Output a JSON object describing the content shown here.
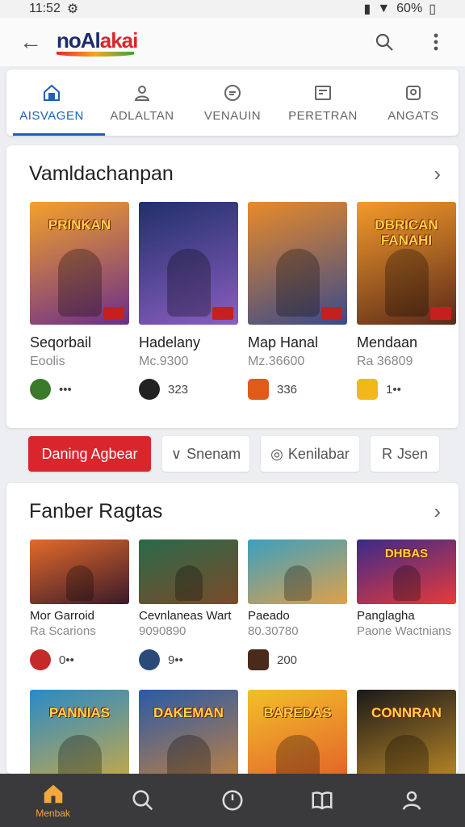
{
  "status": {
    "time": "11:52",
    "battery": "60%"
  },
  "app": {
    "logo_part1": "noAl",
    "logo_part2": "akai"
  },
  "tabs": [
    {
      "label": "AISVAGEN",
      "icon": "home-icon"
    },
    {
      "label": "ADLALTAN",
      "icon": "person-icon"
    },
    {
      "label": "VENAUIN",
      "icon": "badge-icon"
    },
    {
      "label": "PERETRAN",
      "icon": "board-icon"
    },
    {
      "label": "ANGATS",
      "icon": "tag-icon"
    }
  ],
  "section1": {
    "title": "Vamldachanpan",
    "games": [
      {
        "name": "Seqorbail",
        "sub": "Eoolis",
        "meta": "•••",
        "thumb_text": "PRINKAN",
        "avatar_color": "#3a7a2a",
        "colors": [
          "#f4a12a",
          "#6a2e8a"
        ]
      },
      {
        "name": "Hadelany",
        "sub": "Mc.9300",
        "meta": "323",
        "thumb_text": "",
        "avatar_color": "#222222",
        "colors": [
          "#20306a",
          "#8a5ec0"
        ]
      },
      {
        "name": "Map Hanal",
        "sub": "Mz.36600",
        "meta": "336",
        "thumb_text": "",
        "avatar_color": "#e05a1a",
        "colors": [
          "#e88a2a",
          "#3a4a8a"
        ]
      },
      {
        "name": "Mendaan",
        "sub": "Ra 36809",
        "meta": "1••",
        "thumb_text": "DBRICAN FANAHI",
        "avatar_color": "#f2b81a",
        "colors": [
          "#f59a2a",
          "#5a2a1a"
        ]
      }
    ]
  },
  "chips": [
    {
      "label": "Daning Agbear"
    },
    {
      "label": "Snenam",
      "prefix": "∨"
    },
    {
      "label": "Kenilabar",
      "prefix": "◎"
    },
    {
      "label": "Jsen",
      "prefix": "R"
    }
  ],
  "section2": {
    "title": "Fanber Ragtas",
    "games": [
      {
        "name": "Mor Garroid",
        "sub": "Ra Scarions",
        "meta": "0••",
        "thumb_text": "",
        "avatar_color": "#c42a2a",
        "colors": [
          "#e36a2a",
          "#3a1a2a"
        ]
      },
      {
        "name": "Cevnlaneas Wart",
        "sub": "9090890",
        "meta": "9••",
        "thumb_text": "",
        "avatar_color": "#2a4a7a",
        "colors": [
          "#2a6a4a",
          "#7a4a2a"
        ]
      },
      {
        "name": "Paeado",
        "sub": "80.30780",
        "meta": "200",
        "thumb_text": "",
        "avatar_color": "#4a2a1a",
        "colors": [
          "#3aa0c0",
          "#e0a04a"
        ]
      },
      {
        "name": "Panglagha",
        "sub": "Paone Wactnians",
        "meta": "",
        "thumb_text": "DHBAS",
        "avatar_color": "#ffffff",
        "colors": [
          "#3a2a8a",
          "#e83a3a"
        ]
      }
    ],
    "more_games": [
      {
        "thumb_text": "PANNIAS",
        "colors": [
          "#2a8ac8",
          "#e8b02a"
        ]
      },
      {
        "thumb_text": "DAKEMAN",
        "colors": [
          "#2a5aa8",
          "#e08a2a"
        ]
      },
      {
        "thumb_text": "BAREDAS",
        "colors": [
          "#f2c02a",
          "#e04a2a"
        ]
      },
      {
        "thumb_text": "CONNRAN",
        "colors": [
          "#1a1a1a",
          "#e0a02a"
        ]
      }
    ]
  },
  "bottom_nav": [
    {
      "label": "Menbak",
      "icon": "home-icon"
    },
    {
      "label": "",
      "icon": "search-icon"
    },
    {
      "label": "",
      "icon": "clock-icon"
    },
    {
      "label": "",
      "icon": "book-icon"
    },
    {
      "label": "",
      "icon": "profile-icon"
    }
  ]
}
